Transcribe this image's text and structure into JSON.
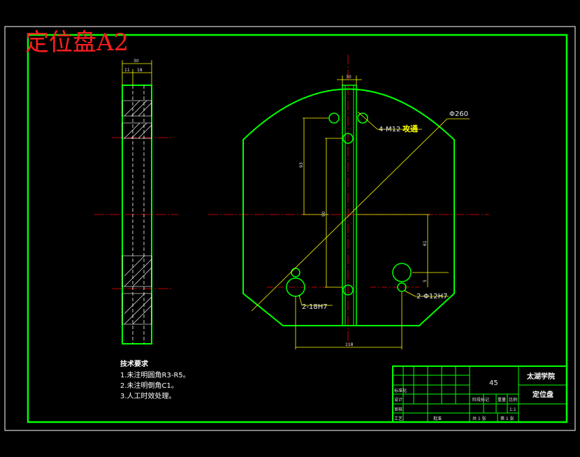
{
  "stamp": "定位盘A2",
  "front_view": {
    "dims": {
      "thread": "4-M12",
      "thread_note": "攻通",
      "diameter": "Φ260",
      "hole_large": "2-18H7",
      "hole_small": "2-Φ12H7",
      "width_top": "30",
      "v_left": "93",
      "v_center": "90",
      "v_right": "61",
      "v_right_small": "5",
      "bottom": "118"
    }
  },
  "side_view": {
    "dims": {
      "total": "30",
      "part_a": "11",
      "part_b": "18"
    }
  },
  "notes": {
    "title": "技术要求",
    "items": [
      "1.未注明圆角R3-R5。",
      "2.未注明倒角C1。",
      "3.人工时效处理。"
    ]
  },
  "title_block": {
    "material": "45",
    "school": "太湖学院",
    "part_name": "定位盘",
    "labels": {
      "process": "工艺",
      "approve": "批准",
      "standard": "标准化",
      "design": "设计",
      "review": "审核",
      "stage_mark": "阶段标记",
      "weight": "重量",
      "scale": "比例",
      "scale_value": "1:1",
      "sheets_total": "共 1 张",
      "sheet_no": "第 1 张"
    }
  },
  "colors": {
    "background": "#000000",
    "frame": "#00ff00",
    "center_line": "#ff0000",
    "dimension": "#ffff00",
    "text": "#ffffff",
    "stamp": "#ff1e1e"
  }
}
